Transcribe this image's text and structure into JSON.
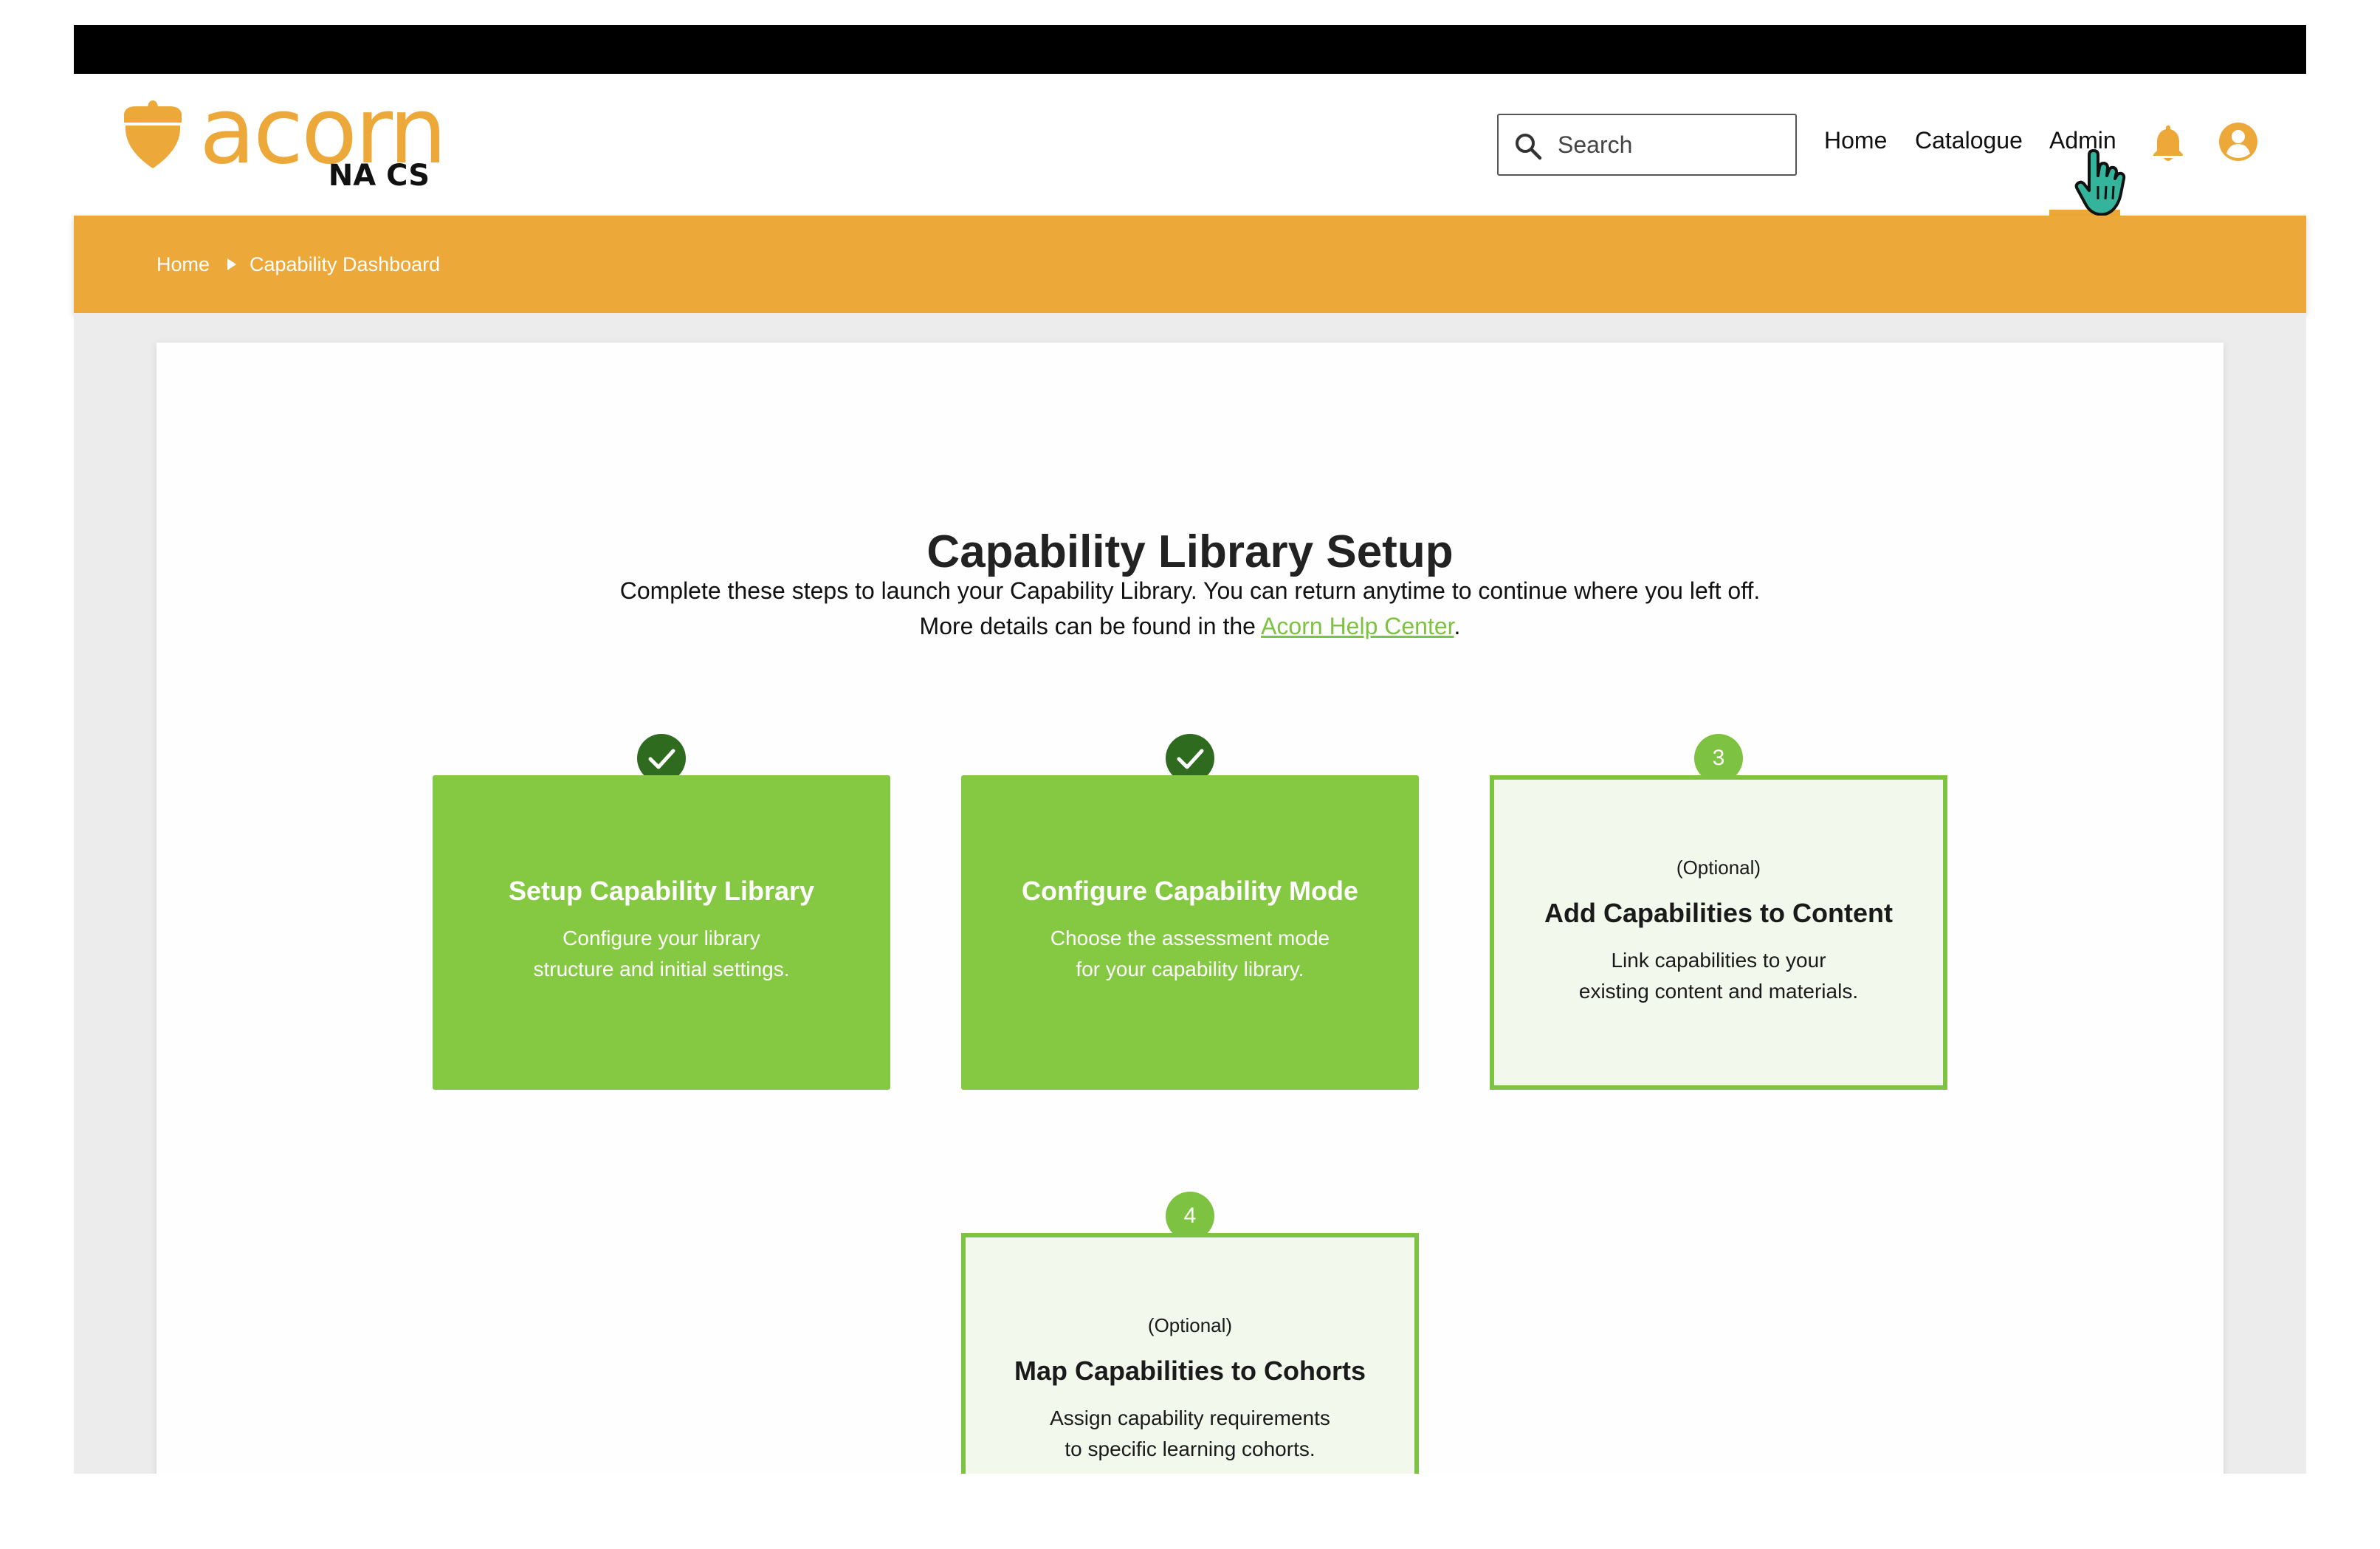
{
  "header": {
    "logo": {
      "word": "acorn",
      "sub": "NA CS"
    },
    "search": {
      "placeholder": "Search",
      "value": ""
    },
    "nav": [
      {
        "label": "Home"
      },
      {
        "label": "Catalogue"
      },
      {
        "label": "Admin",
        "active": true
      }
    ],
    "icons": [
      "search-icon",
      "bell-icon",
      "user-account-icon",
      "hand-pointer-cursor"
    ]
  },
  "breadcrumb": {
    "home": "Home",
    "separator_icon": "triangle-right-icon",
    "current": "Capability Dashboard"
  },
  "main": {
    "title": "Capability Library Setup",
    "desc_line1": "Complete these steps to launch your Capability Library. You can return anytime to continue where you left off.",
    "desc_line2_prefix": "More details can be found in the ",
    "help_link": "Acorn Help Center",
    "desc_line2_suffix": ".",
    "steps": [
      {
        "status": "complete",
        "marker_icon": "checkmark-icon",
        "optional": "",
        "title": "Setup Capability Library",
        "desc_line1": "Configure your library",
        "desc_line2": "structure and initial settings."
      },
      {
        "status": "complete",
        "marker_icon": "checkmark-icon",
        "optional": "",
        "title": "Configure Capability Mode",
        "desc_line1": "Choose the assessment mode",
        "desc_line2": "for your capability library."
      },
      {
        "status": "pending",
        "marker": "3",
        "optional": "(Optional)",
        "title": "Add Capabilities to Content",
        "desc_line1": "Link capabilities to your",
        "desc_line2": "existing content and materials."
      },
      {
        "status": "pending",
        "marker": "4",
        "optional": "(Optional)",
        "title": "Map Capabilities to Cohorts",
        "desc_line1": "Assign capability requirements",
        "desc_line2": "to specific learning cohorts."
      }
    ]
  },
  "colors": {
    "brand_orange": "#EDA83A",
    "step_green": "#85C943",
    "step_outline_green": "#7DC241",
    "check_dark_green": "#2F6B1F",
    "link_green": "#7DC241"
  }
}
